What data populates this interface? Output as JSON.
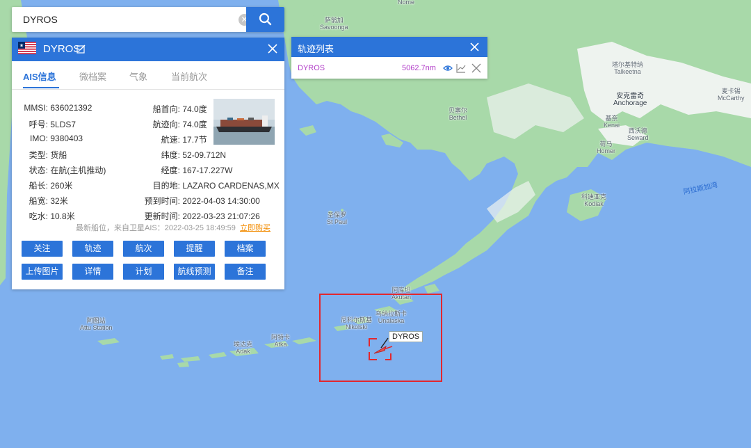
{
  "search": {
    "value": "DYROS"
  },
  "ship": {
    "name": "DYROS",
    "tabs": [
      "AIS信息",
      "微档案",
      "气象",
      "当前航次"
    ],
    "info_left": [
      {
        "label": "MMSI:",
        "value": "636021392"
      },
      {
        "label": "呼号:",
        "value": "5LDS7"
      },
      {
        "label": "IMO:",
        "value": "9380403"
      },
      {
        "label": "类型:",
        "value": "货船"
      },
      {
        "label": "状态:",
        "value": "在航(主机推动)"
      },
      {
        "label": "船长:",
        "value": "260米"
      },
      {
        "label": "船宽:",
        "value": "32米"
      },
      {
        "label": "吃水:",
        "value": "10.8米"
      }
    ],
    "info_right": [
      {
        "label": "船首向:",
        "value": "74.0度"
      },
      {
        "label": "航迹向:",
        "value": "74.0度"
      },
      {
        "label": "航速:",
        "value": "17.7节"
      },
      {
        "label": "纬度:",
        "value": "52-09.712N"
      },
      {
        "label": "经度:",
        "value": "167-17.227W"
      },
      {
        "label": "目的地:",
        "value": "LAZARO CARDENAS,MX"
      },
      {
        "label": "预到时间:",
        "value": "2022-04-03 14:30:00"
      },
      {
        "label": "更新时间:",
        "value": "2022-03-23 21:07:26"
      }
    ],
    "latest_position": "最新船位，来自卫星AIS：2022-03-25 18:49:59",
    "buy_link": "立即购买",
    "buttons_row1": [
      "关注",
      "轨迹",
      "航次",
      "提醒",
      "档案"
    ],
    "buttons_row2": [
      "上传图片",
      "详情",
      "计划",
      "航线预测",
      "备注"
    ]
  },
  "track_list": {
    "title": "轨迹列表",
    "items": [
      {
        "name": "DYROS",
        "distance": "5062.7nm"
      }
    ]
  },
  "map": {
    "labels": [
      {
        "text": "萨翁加\nSavoonga"
      },
      {
        "text": "贝塞尔\nBethel"
      },
      {
        "text": "塔尔基特纳\nTalkeetna"
      },
      {
        "text": "安克雷奇\nAnchorage"
      },
      {
        "text": "基奈\nKenai"
      },
      {
        "text": "西沃德\nSeward"
      },
      {
        "text": "荷马\nHomer"
      },
      {
        "text": "麦卡锡\nMcCarthy"
      },
      {
        "text": "科迪亚克\nKodiak"
      },
      {
        "text": "圣保罗\nSt Paul"
      },
      {
        "text": "阿库坦\nAkutan"
      },
      {
        "text": "乌纳拉斯卡\nUnalaska"
      },
      {
        "text": "尼科尔斯基\nNikolski"
      },
      {
        "text": "阿图站\nAttu Station"
      },
      {
        "text": "阿特卡\nAtka"
      },
      {
        "text": "埃达克\nAdak"
      },
      {
        "text": "Nome"
      }
    ],
    "sea_label": "阿拉斯加湾",
    "ship_tag": "DYROS",
    "colors": {
      "sea": "#7fb0ee",
      "land": "#a8d9a9",
      "snow": "#f2f4f3",
      "accent": "#2c74d9",
      "highlight": "#e3272d"
    }
  }
}
